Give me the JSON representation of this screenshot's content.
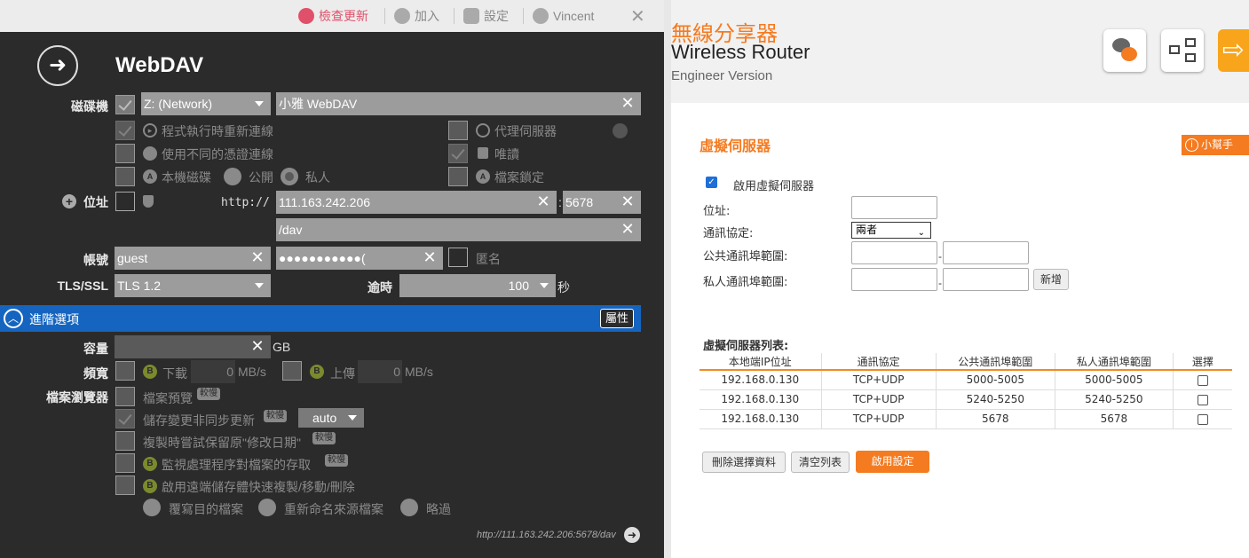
{
  "left": {
    "toolbar": {
      "check_update": "檢查更新",
      "join": "加入",
      "settings": "設定",
      "user": "Vincent"
    },
    "title": "WebDAV",
    "labels": {
      "drive": "磁碟機",
      "address": "位址",
      "account": "帳號",
      "tls": "TLS/SSL",
      "timeout": "逾時",
      "seconds": "秒",
      "capacity": "容量",
      "gb": "GB",
      "bandwidth": "頻寬",
      "file_browser": "檔案瀏覽器"
    },
    "drive_letter": "Z: (Network)",
    "drive_name": "小雅 WebDAV",
    "options": {
      "reconnect": "程式執行時重新連線",
      "proxy": "代理伺服器",
      "diff_credentials": "使用不同的憑證連線",
      "readonly": "唯讀",
      "local_disk": "本機磁碟",
      "public": "公開",
      "private": "私人",
      "file_lock": "檔案鎖定"
    },
    "scheme": "http://",
    "host": "111.163.242.206",
    "port": "5678",
    "path": "/dav",
    "username": "guest",
    "password": "●●●●●●●●●●●(",
    "anonymous": "匿名",
    "tls_value": "TLS 1.2",
    "timeout_value": "100",
    "advanced": "進階選項",
    "properties": "屬性",
    "download": "下載",
    "upload": "上傳",
    "download_value": "0",
    "upload_value": "0",
    "speed_unit": "MB/s",
    "browser": {
      "preview": "檔案預覽",
      "async_save": "儲存變更非同步更新",
      "keep_date": "複製時嘗試保留原\"修改日期\"",
      "monitor": "監視處理程序對檔案的存取",
      "remote_copy": "啟用遠端儲存體快速複製/移動/刪除",
      "overwrite": "覆寫目的檔案",
      "rename_src": "重新命名來源檔案",
      "skip": "略過",
      "tag": "較慢",
      "async_value": "auto"
    },
    "footer_url": "http://111.163.242.206:5678/dav"
  },
  "right": {
    "title_cn": "無線分享器",
    "title_en": "Wireless Router",
    "subtitle": "Engineer Version",
    "section_title": "虛擬伺服器",
    "help": "小幫手",
    "enable": "啟用虛擬伺服器",
    "fields": {
      "address": "位址:",
      "protocol": "通訊協定:",
      "public_range": "公共通訊埠範圍:",
      "private_range": "私人通訊埠範圍:"
    },
    "protocol_value": "兩者",
    "add": "新增",
    "list_title": "虛擬伺服器列表:",
    "columns": [
      "本地端IP位址",
      "通訊協定",
      "公共通訊埠範圍",
      "私人通訊埠範圍",
      "選擇"
    ],
    "rows": [
      [
        "192.168.0.130",
        "TCP+UDP",
        "5000-5005",
        "5000-5005"
      ],
      [
        "192.168.0.130",
        "TCP+UDP",
        "5240-5250",
        "5240-5250"
      ],
      [
        "192.168.0.130",
        "TCP+UDP",
        "5678",
        "5678"
      ]
    ],
    "buttons": {
      "delete": "刪除選擇資料",
      "clear": "清空列表",
      "apply": "啟用設定"
    },
    "colors": {
      "accent": "#f47b20"
    }
  }
}
